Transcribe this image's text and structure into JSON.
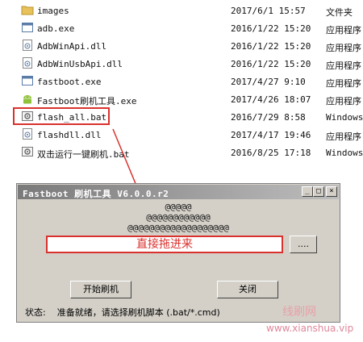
{
  "files": [
    {
      "name": "images",
      "date": "2017/6/1 15:57",
      "type": "文件夹",
      "icon": "folder-icon"
    },
    {
      "name": "adb.exe",
      "date": "2016/1/22 15:20",
      "type": "应用程序",
      "icon": "exe-icon"
    },
    {
      "name": "AdbWinApi.dll",
      "date": "2016/1/22 15:20",
      "type": "应用程序",
      "icon": "dll-icon"
    },
    {
      "name": "AdbWinUsbApi.dll",
      "date": "2016/1/22 15:20",
      "type": "应用程序",
      "icon": "dll-icon"
    },
    {
      "name": "fastboot.exe",
      "date": "2017/4/27 9:10",
      "type": "应用程序",
      "icon": "exe-icon"
    },
    {
      "name": "Fastboot刷机工具.exe",
      "date": "2017/4/26 18:07",
      "type": "应用程序",
      "icon": "android-icon"
    },
    {
      "name": "flash_all.bat",
      "date": "2016/7/29 8:58",
      "type": "Windows",
      "icon": "bat-icon"
    },
    {
      "name": "flashdll.dll",
      "date": "2017/4/17 19:46",
      "type": "应用程序",
      "icon": "dll-icon"
    },
    {
      "name": "双击运行一键刷机.bat",
      "date": "2016/8/25 17:18",
      "type": "Windows",
      "icon": "bat-icon"
    }
  ],
  "dialog": {
    "title": "Fastboot 刷机工具 V6.0.0.r2",
    "art": [
      "@@@@@",
      "@@@@@@@@@@@@",
      "@@@@@@@@@@@@@@@@@@@"
    ],
    "input_value": "直接拖进来",
    "browse_label": "....",
    "start_label": "开始刷机",
    "close_label": "关闭",
    "status_label": "状态:",
    "status_text": "准备就绪，请选择刷机脚本 (.bat/*.cmd)"
  },
  "watermark": {
    "cn": "线刷网",
    "en": "www.xianshua.vip"
  }
}
